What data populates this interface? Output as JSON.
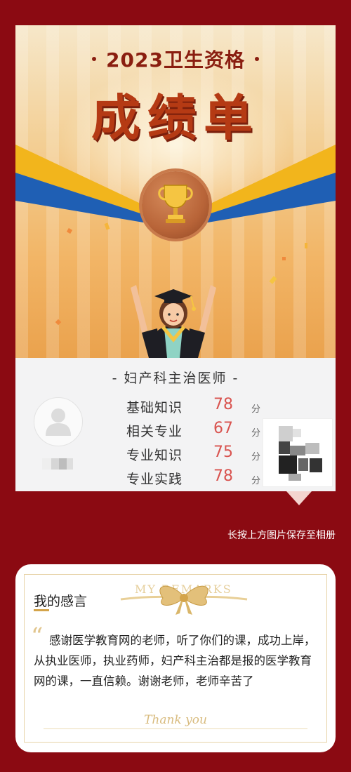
{
  "certificate": {
    "subtitle": "2023卫生资格",
    "title": "成绩单",
    "level": "- 妇产科主治医师 -",
    "scores": [
      {
        "subject": "基础知识",
        "score": "78",
        "unit": "分"
      },
      {
        "subject": "相关专业",
        "score": "67",
        "unit": "分"
      },
      {
        "subject": "专业知识",
        "score": "75",
        "unit": "分"
      },
      {
        "subject": "专业实践",
        "score": "78",
        "unit": "分"
      }
    ]
  },
  "save_hint": "长按上方图片保存至相册",
  "comments": {
    "heading": "我的感言",
    "decor_text": "MY REMARKS",
    "body": "感谢医学教育网的老师，听了你们的课，成功上岸，从执业医师，执业药师，妇产科主治都是报的医学教育网的课，一直信赖。谢谢老师，老师辛苦了",
    "signoff": "Thank you"
  },
  "colors": {
    "background": "#8b0a12",
    "score": "#d9534f",
    "title": "#b53a14",
    "accent_gold": "#d4a44a"
  }
}
